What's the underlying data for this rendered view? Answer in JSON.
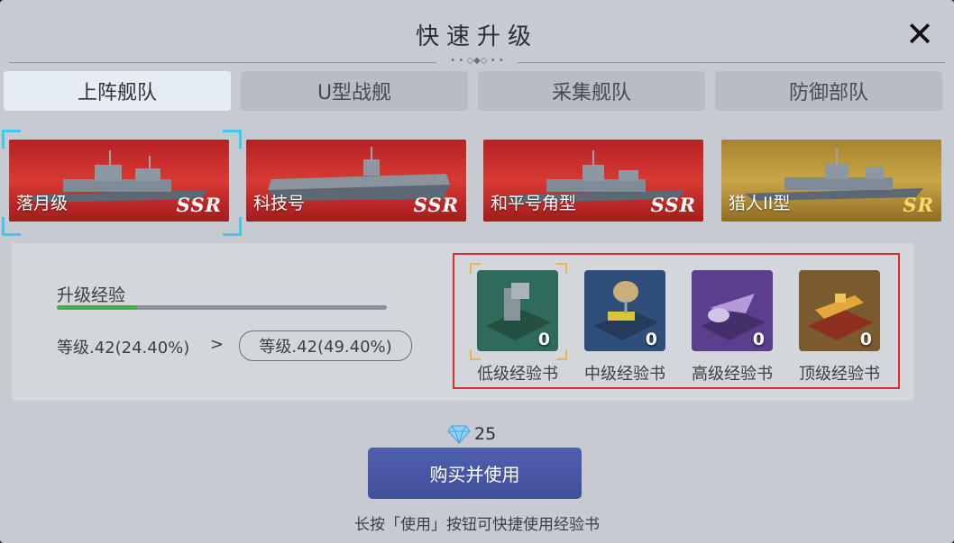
{
  "title": "快速升级",
  "close_icon": "close-icon",
  "tabs": [
    {
      "label": "上阵舰队",
      "active": true
    },
    {
      "label": "U型战舰",
      "active": false
    },
    {
      "label": "采集舰队",
      "active": false
    },
    {
      "label": "防御部队",
      "active": false
    }
  ],
  "ships": [
    {
      "name": "落月级",
      "rank": "SSR",
      "selected": true
    },
    {
      "name": "科技号",
      "rank": "SSR",
      "selected": false
    },
    {
      "name": "和平号角型",
      "rank": "SSR",
      "selected": false
    },
    {
      "name": "猎人II型",
      "rank": "SR",
      "selected": false
    }
  ],
  "exp": {
    "label": "升级经验",
    "progress": 0.244,
    "current_level": "等级.42(24.40%)",
    "arrow": ">",
    "next_level": "等级.42(49.40%)"
  },
  "books": [
    {
      "label": "低级经验书",
      "count": "0",
      "color": "#2f6b5a",
      "selected": true
    },
    {
      "label": "中级经验书",
      "count": "0",
      "color": "#2f4f7a",
      "selected": false
    },
    {
      "label": "高级经验书",
      "count": "0",
      "color": "#5a3f8f",
      "selected": false
    },
    {
      "label": "顶级经验书",
      "count": "0",
      "color": "#7a5a2e",
      "selected": false
    }
  ],
  "price": {
    "icon": "diamond-icon",
    "amount": "25"
  },
  "buy_button": "购买并使用",
  "hint": "长按「使用」按钮可快捷使用经验书",
  "colors": {
    "accent": "#3f4f99",
    "selection": "#3fc8f0",
    "highlight_border": "#d8302c",
    "progress": "#3eb24a"
  }
}
